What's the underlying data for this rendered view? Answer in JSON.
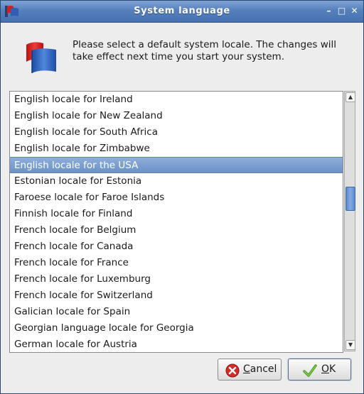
{
  "window": {
    "title": "System language",
    "controls": {
      "minimize": "–",
      "maximize": "□",
      "close": "✕"
    }
  },
  "header": {
    "icon": "flag-icon",
    "message": "Please select a default system locale. The changes will take effect next time you start your system."
  },
  "locales": [
    "English locale for Ireland",
    "English locale for New Zealand",
    "English locale for South Africa",
    "English locale for Zimbabwe",
    "English locale for the USA",
    "Estonian locale for Estonia",
    "Faroese locale for Faroe Islands",
    "Finnish locale for Finland",
    "French locale for Belgium",
    "French locale for Canada",
    "French locale for France",
    "French locale for Luxemburg",
    "French locale for Switzerland",
    "Galician locale for Spain",
    "Georgian language locale for Georgia",
    "German locale for Austria"
  ],
  "selected_locale": "English locale for the USA",
  "buttons": {
    "cancel": {
      "label": "Cancel",
      "mnemonic": "C",
      "icon": "cancel-icon"
    },
    "ok": {
      "label": "OK",
      "mnemonic": "O",
      "icon": "checkmark-icon"
    }
  },
  "colors": {
    "titlebar": "#5680bd",
    "selection": "#7a9dd0",
    "scroll_thumb": "#6f97d6"
  }
}
